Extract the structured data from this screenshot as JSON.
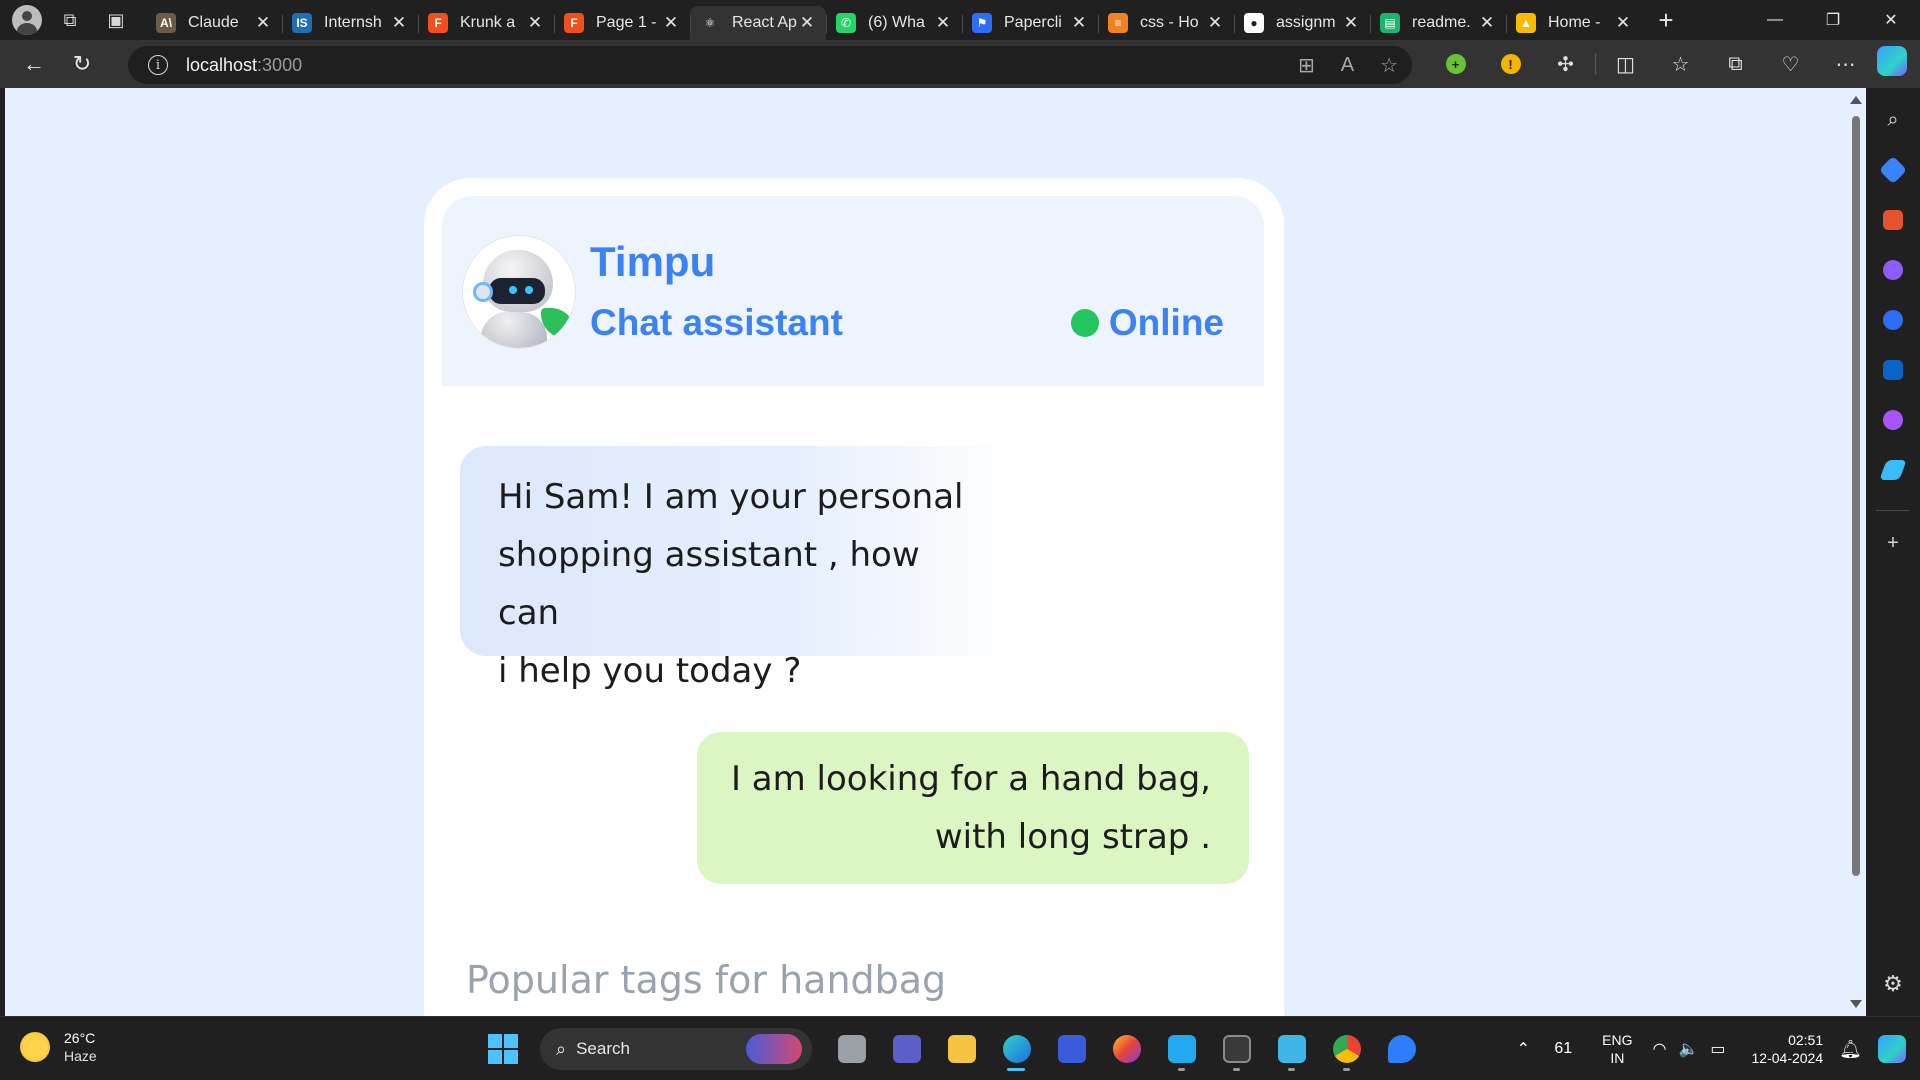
{
  "browser": {
    "tabs": [
      {
        "title": "Claude",
        "favicon": "anthropic-icon",
        "color": "#6b5b4a",
        "glyph": "A\\"
      },
      {
        "title": "Internsh",
        "favicon": "internshala-icon",
        "color": "#1f6fb2",
        "glyph": "IS"
      },
      {
        "title": "Krunk a",
        "favicon": "figma-icon",
        "color": "#f24e1e",
        "glyph": "F"
      },
      {
        "title": "Page 1 -",
        "favicon": "figma-icon",
        "color": "#f24e1e",
        "glyph": "F"
      },
      {
        "title": "React Ap",
        "favicon": "react-icon",
        "color": "#333333",
        "glyph": "⚛"
      },
      {
        "title": "(6) Wha",
        "favicon": "whatsapp-icon",
        "color": "#25d366",
        "glyph": "✆"
      },
      {
        "title": "Papercli",
        "favicon": "paperclip-icon",
        "color": "#2f6df6",
        "glyph": "⚑"
      },
      {
        "title": "css - Ho",
        "favicon": "stackoverflow-icon",
        "color": "#f48024",
        "glyph": "≡"
      },
      {
        "title": "assignm",
        "favicon": "github-icon",
        "color": "#ffffff",
        "glyph": "●"
      },
      {
        "title": "readme.",
        "favicon": "docs-icon",
        "color": "#1fb46b",
        "glyph": "▤"
      },
      {
        "title": "Home -",
        "favicon": "google-drive-icon",
        "color": "#f9bb00",
        "glyph": "▲"
      }
    ],
    "active_tab_index": 4,
    "url_host": "localhost",
    "url_port": ":3000"
  },
  "chat": {
    "bot_name": "Timpu",
    "bot_role": "Chat assistant",
    "status": "Online",
    "status_color": "#22c55e",
    "accent_color": "#3c82f0",
    "messages": [
      {
        "from": "bot",
        "lines": [
          "Hi Sam! I am your personal",
          "shopping assistant , how can",
          "i help you today ?"
        ]
      },
      {
        "from": "user",
        "lines": [
          "I am looking for a hand bag,",
          "with long strap ."
        ]
      }
    ],
    "tags_title": "Popular tags for handbag"
  },
  "taskbar": {
    "weather_temp": "26°C",
    "weather_cond": "Haze",
    "search_label": "Search",
    "tray_number": "61",
    "lang_top": "ENG",
    "lang_bottom": "IN",
    "time": "02:51",
    "date": "12-04-2024"
  }
}
